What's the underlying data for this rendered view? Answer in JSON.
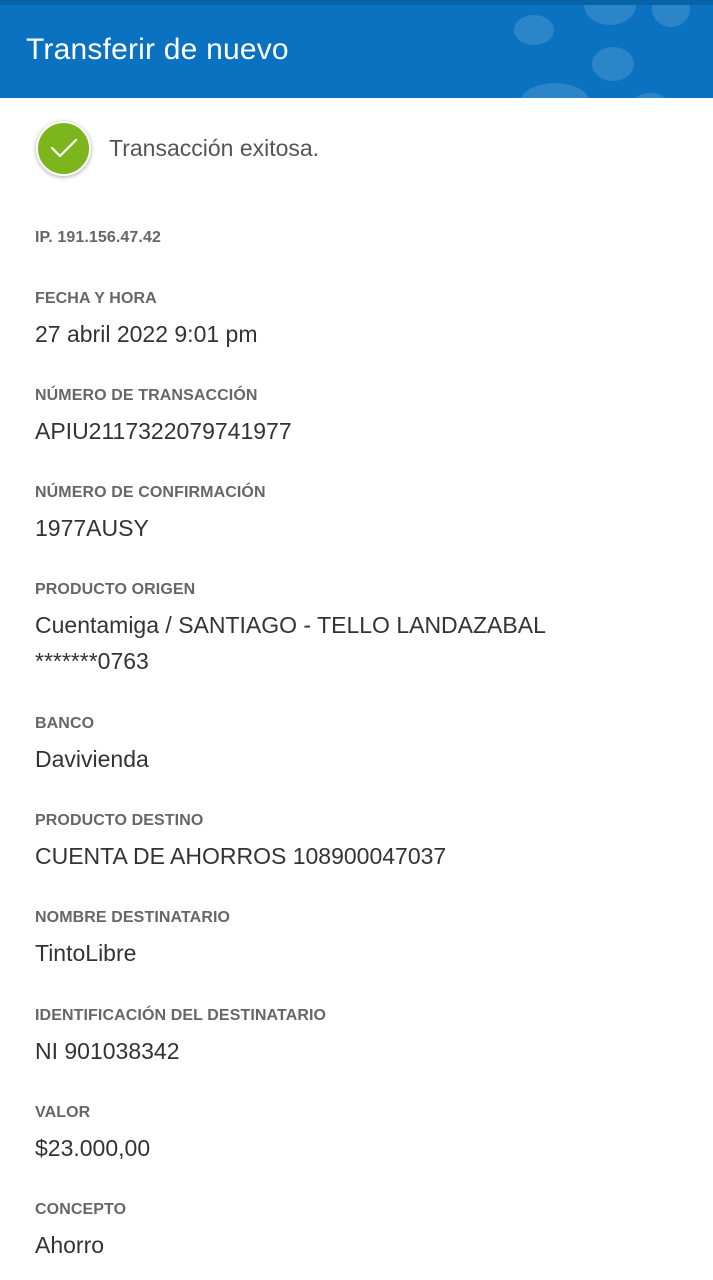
{
  "header": {
    "title": "Transferir de nuevo",
    "background_color": "#0a72c1"
  },
  "status": {
    "icon": "check-circle-icon",
    "text": "Transacción exitosa.",
    "icon_color": "#7cb51c"
  },
  "ip": "IP. 191.156.47.42",
  "fields": [
    {
      "label": "FECHA Y HORA",
      "value": "27 abril 2022 9:01 pm"
    },
    {
      "label": "NÚMERO DE TRANSACCIÓN",
      "value": "APIU2117322079741977"
    },
    {
      "label": "NÚMERO DE CONFIRMACIÓN",
      "value": "1977AUSY"
    },
    {
      "label": "PRODUCTO ORIGEN",
      "value": "Cuentamiga / SANTIAGO - TELLO LANDAZABAL",
      "value2": "*******0763"
    },
    {
      "label": "BANCO",
      "value": "Davivienda"
    },
    {
      "label": "PRODUCTO DESTINO",
      "value": "CUENTA DE AHORROS 108900047037"
    },
    {
      "label": "NOMBRE DESTINATARIO",
      "value": "TintoLibre"
    },
    {
      "label": "IDENTIFICACIÓN DEL DESTINATARIO",
      "value": "NI 901038342"
    },
    {
      "label": "VALOR",
      "value": "$23.000,00"
    },
    {
      "label": "CONCEPTO",
      "value": "Ahorro"
    }
  ]
}
